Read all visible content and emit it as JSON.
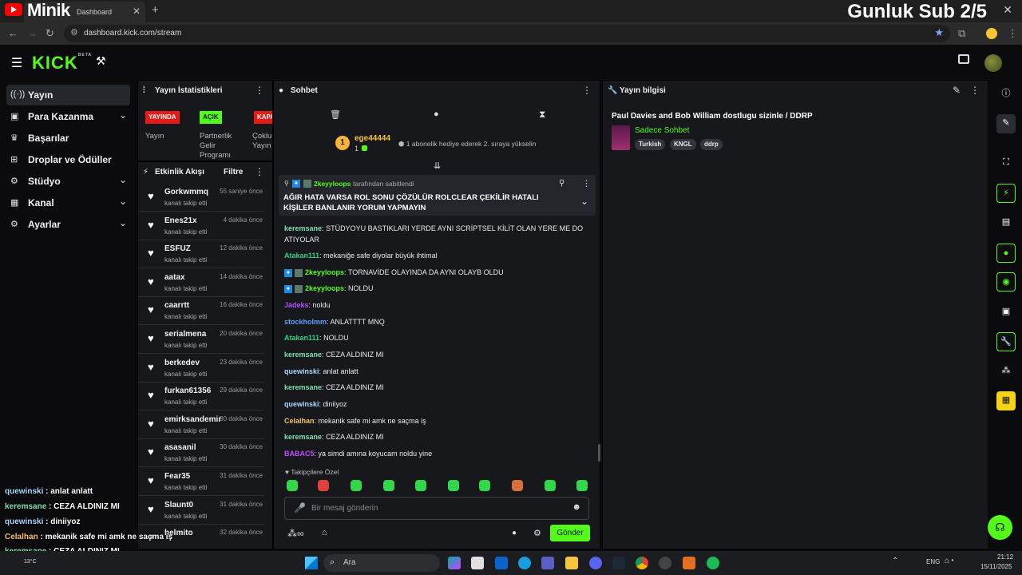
{
  "browser": {
    "tab_title": "Dashboard",
    "overlay_left": "Minik",
    "overlay_right": "Gunluk Sub 2/5",
    "url": "dashboard.kick.com/stream"
  },
  "header": {
    "logo": "KICK",
    "logo_tag": "BETA"
  },
  "sidebar": {
    "items": [
      {
        "label": "Yayın",
        "icon": "broadcast-icon"
      },
      {
        "label": "Para Kazanma",
        "icon": "money-icon"
      },
      {
        "label": "Başarılar",
        "icon": "trophy-icon"
      },
      {
        "label": "Droplar ve Ödüller",
        "icon": "gift-icon"
      },
      {
        "label": "Stüdyo",
        "icon": "studio-icon"
      },
      {
        "label": "Kanal",
        "icon": "channel-icon"
      },
      {
        "label": "Ayarlar",
        "icon": "gear-icon"
      }
    ]
  },
  "stats": {
    "title": "Yayın İstatistikleri",
    "badges": [
      {
        "text": "YAYINDA",
        "color": "#e91916"
      },
      {
        "text": "AÇIK",
        "color": "#53fc18"
      },
      {
        "text": "KAPA",
        "color": "#e91916"
      }
    ],
    "labels": [
      "Yayın",
      "Partnerlik Gelir Programı",
      "Çoklu Yayın"
    ]
  },
  "feed": {
    "title": "Etkinlik Akışı",
    "filter": "Filtre",
    "rows": [
      {
        "name": "Gorkwmmq",
        "sub": "kanalı takip etti",
        "time": "55 saniye önce"
      },
      {
        "name": "Enes21x",
        "sub": "kanalı takip etti",
        "time": "4 dakika önce"
      },
      {
        "name": "ESFUZ",
        "sub": "kanalı takip etti",
        "time": "12 dakika önce"
      },
      {
        "name": "aatax",
        "sub": "kanalı takip etti",
        "time": "14 dakika önce"
      },
      {
        "name": "caarrtt",
        "sub": "kanalı takip etti",
        "time": "16 dakika önce"
      },
      {
        "name": "serialmena",
        "sub": "kanalı takip etti",
        "time": "20 dakika önce"
      },
      {
        "name": "berkedev",
        "sub": "kanalı takip etti",
        "time": "23 dakika önce"
      },
      {
        "name": "furkan61356",
        "sub": "kanalı takip etti",
        "time": "29 dakika önce"
      },
      {
        "name": "emirksandemir",
        "sub": "kanalı takip etti",
        "time": "30 dakika önce"
      },
      {
        "name": "asasanil",
        "sub": "kanalı takip etti",
        "time": "30 dakika önce"
      },
      {
        "name": "Fear35",
        "sub": "kanalı takip etti",
        "time": "31 dakika önce"
      },
      {
        "name": "Slaunt0",
        "sub": "kanalı takip etti",
        "time": "31 dakika önce"
      },
      {
        "name": "helmito",
        "sub": "",
        "time": "32 dakika önce"
      }
    ]
  },
  "chat": {
    "title": "Sohbet",
    "gift": {
      "user": "ege44444",
      "count": "1",
      "rank": "1",
      "text": "1 abonelik hediye ederek 2. sıraya yükselin"
    },
    "pinned": {
      "by_user": "2keyyloops",
      "by_text": "tarafından sabitlendi",
      "message": "AĞIR HATA VARSA ROL SONU ÇÖZÜLÜR ROLCLEAR ÇEKİLİR HATALI KİŞİLER BANLANIR YORUM YAPMAYIN"
    },
    "messages": [
      {
        "user": "keremsane",
        "color": "#7ee0b0",
        "text": "STÜDYOYU BASTIKLARI YERDE AYNI SCRİPTSEL KİLİT OLAN YERE ME DO ATIYOLAR",
        "mod": false
      },
      {
        "user": "Atakan111",
        "color": "#2fcf86",
        "text": "mekaniğe safe diyolar büyük ihtimal",
        "mod": false
      },
      {
        "user": "2keyyloops",
        "color": "#53fc18",
        "text": "TORNAVİDE OLAYINDA DA AYNI OLAYB OLDU",
        "mod": true
      },
      {
        "user": "2keyyloops",
        "color": "#53fc18",
        "text": "NOLDU",
        "mod": true
      },
      {
        "user": "Jadeks",
        "color": "#b54cff",
        "text": "noldu",
        "mod": false
      },
      {
        "user": "stockholmm",
        "color": "#5aa0ff",
        "text": "ANLATTTT MNQ",
        "mod": false
      },
      {
        "user": "Atakan111",
        "color": "#2fcf86",
        "text": "NOLDU",
        "mod": false
      },
      {
        "user": "keremsane",
        "color": "#7ee0b0",
        "text": "CEZA ALDINIZ MI",
        "mod": false
      },
      {
        "user": "quewinski",
        "color": "#a8d8ff",
        "text": "anlat anlatt",
        "mod": false
      },
      {
        "user": "keremsane",
        "color": "#7ee0b0",
        "text": "CEZA ALDINIZ MI",
        "mod": false
      },
      {
        "user": "quewinski",
        "color": "#a8d8ff",
        "text": "diniiyoz",
        "mod": false
      },
      {
        "user": "Celalhan",
        "color": "#f5c26b",
        "text": "mekanik safe mi amk ne saçma iş",
        "mod": false
      },
      {
        "user": "keremsane",
        "color": "#7ee0b0",
        "text": "CEZA ALDINIZ MI",
        "mod": false
      },
      {
        "user": "BABAC5",
        "color": "#c04cff",
        "text": "ya simdi amına koyucam noldu yine",
        "mod": false
      }
    ],
    "followers_only": "Takipçilere Özel",
    "input_placeholder": "Bir mesaj gönderin",
    "send": "Gönder"
  },
  "stream_info": {
    "title": "Yayın bilgisi",
    "stream_title": "Paul Davies and Bob William dostlugu sizinle / DDRP",
    "category": "Sadece Sohbet",
    "tags": [
      "Turkish",
      "KNGL",
      "ddrp"
    ]
  },
  "overlay_chat": [
    {
      "user": "quewinski",
      "text": "anlat anlatt",
      "color": "#a8d8ff"
    },
    {
      "user": "keremsane",
      "text": "CEZA ALDINIZ MI",
      "color": "#7ee0b0"
    },
    {
      "user": "quewinski",
      "text": "diniiyoz",
      "color": "#a8d8ff"
    },
    {
      "user": "Celalhan",
      "text": "mekanik safe mi amk ne saçma iş",
      "color": "#f5c26b"
    },
    {
      "user": "keremsane",
      "text": "CEZA ALDINIZ MI",
      "color": "#7ee0b0"
    },
    {
      "user": "",
      "text": "simdi amına koyucam noldu yine",
      "color": "#ffffff"
    }
  ],
  "taskbar": {
    "search": "Ara",
    "weather": "13°C",
    "lang": "ENG",
    "time": "21:12",
    "date": "15/11/2025"
  }
}
